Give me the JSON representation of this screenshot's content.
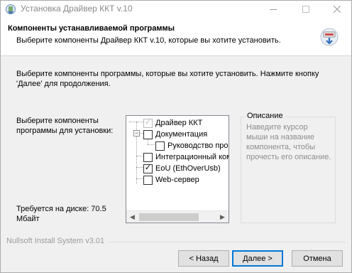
{
  "window": {
    "title": "Установка Драйвер ККТ v.10"
  },
  "header": {
    "title": "Компоненты устанавливаемой программы",
    "subtitle": "Выберите компоненты Драйвер ККТ v.10, которые вы хотите установить."
  },
  "body": {
    "description": "Выберите компоненты программы, которые вы хотите установить. Нажмите кнопку 'Далее' для продолжения.",
    "select_label": "Выберите компоненты программы для установки:",
    "disk_label": "Требуется на диске: 70.5 Мбайт"
  },
  "components": [
    {
      "label": "Драйвер ККТ",
      "state": "checked-disabled"
    },
    {
      "label": "Документация",
      "state": "unchecked",
      "expanded": true
    },
    {
      "label": "Руководство програ",
      "state": "unchecked"
    },
    {
      "label": "Интеграционный комп",
      "state": "unchecked"
    },
    {
      "label": "EoU (EthOverUsb)",
      "state": "checked"
    },
    {
      "label": "Web-сервер",
      "state": "unchecked"
    }
  ],
  "description_group": {
    "title": "Описание",
    "text": "Наведите курсор мыши на название компонента, чтобы прочесть его описание."
  },
  "footer": {
    "brand": "Nullsoft Install System v3.01",
    "back_label": "< Назад",
    "next_label": "Далее >",
    "cancel_label": "Отмена"
  }
}
